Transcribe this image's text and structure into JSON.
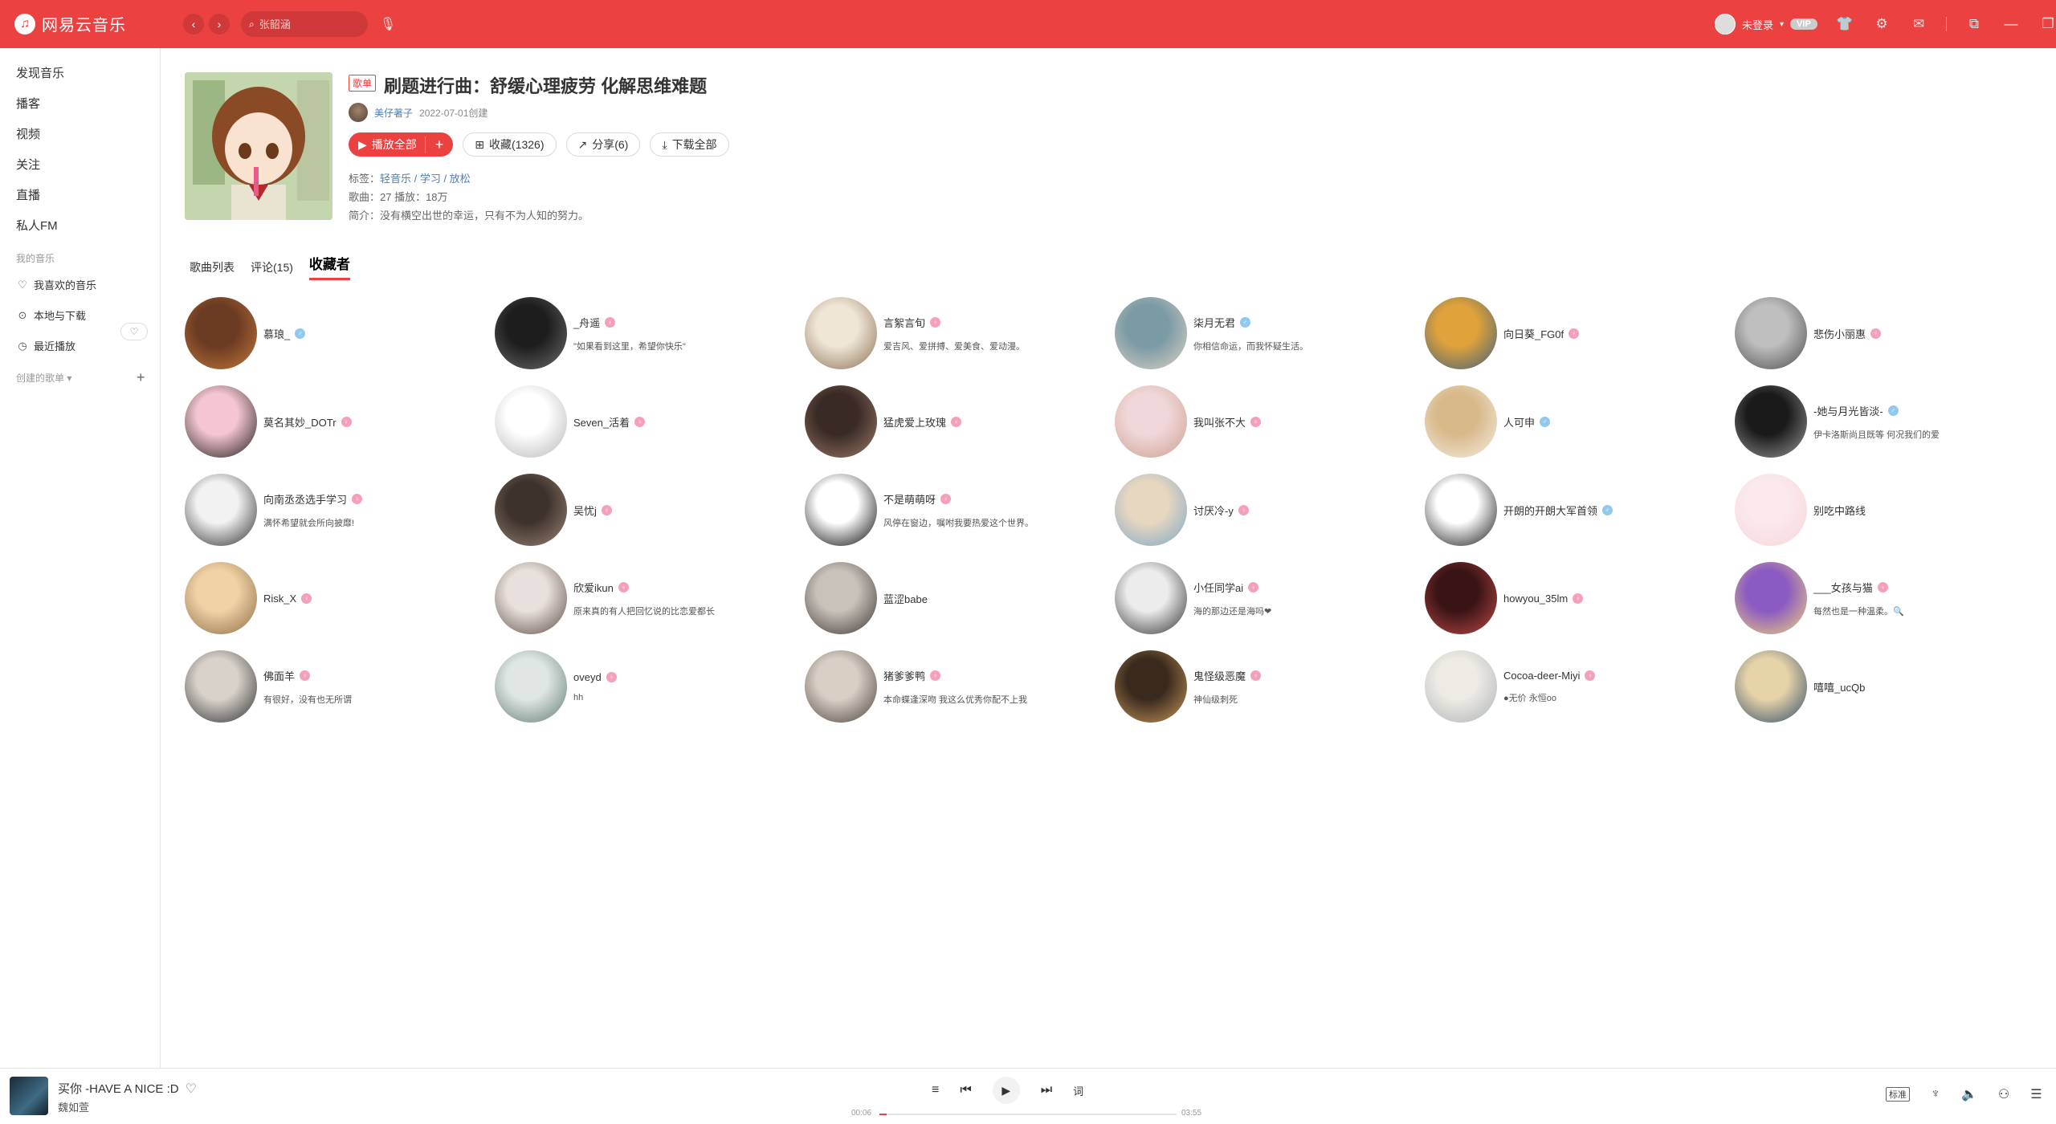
{
  "app": {
    "name": "网易云音乐"
  },
  "search": {
    "placeholder": "张韶涵"
  },
  "user": {
    "name": "未登录",
    "vip": "VIP"
  },
  "sidebar": {
    "items": [
      "发现音乐",
      "播客",
      "视频",
      "关注",
      "直播",
      "私人FM"
    ],
    "my_music_header": "我的音乐",
    "my_music": [
      "我喜欢的音乐",
      "本地与下载",
      "最近播放"
    ],
    "created_header": "创建的歌单"
  },
  "playlist": {
    "tag": "歌单",
    "title": "刷题进行曲：舒缓心理疲劳 化解思维难题",
    "creator": "美仔著子",
    "created": "2022-07-01创建",
    "play_all": "播放全部",
    "collect": "收藏(1326)",
    "share": "分享(6)",
    "download": "下载全部",
    "tags_label": "标签：",
    "tags": "轻音乐 / 学习 / 放松",
    "stats": "歌曲：27    播放：18万",
    "intro": "简介：没有横空出世的幸运，只有不为人知的努力。"
  },
  "tabs": [
    "歌曲列表",
    "评论(15)",
    "收藏者"
  ],
  "subscribers": [
    {
      "name": "慕琅_",
      "sig": "",
      "gender": "m",
      "c1": "#6b3a22",
      "c2": "#c47a3c"
    },
    {
      "name": "_舟遥",
      "sig": "\"如果看到这里，希望你快乐\"",
      "gender": "f",
      "c1": "#1d1d1d",
      "c2": "#6e6e6e"
    },
    {
      "name": "言絮言旬",
      "sig": "爱吉风、爱拼搏、爱美食、爱动漫。",
      "gender": "f",
      "c1": "#efe6d6",
      "c2": "#8a6d52"
    },
    {
      "name": "柒月无君",
      "sig": "你相信命运，而我怀疑生活。",
      "gender": "m",
      "c1": "#7a9aa6",
      "c2": "#dcd2c0"
    },
    {
      "name": "向日葵_FG0f",
      "sig": "",
      "gender": "f",
      "c1": "#e0a23a",
      "c2": "#3c5f7e"
    },
    {
      "name": "悲伤小丽惠",
      "sig": "",
      "gender": "f",
      "c1": "#bfbfbf",
      "c2": "#4a4a4a"
    },
    {
      "name": "莫名其妙_DOTr",
      "sig": "",
      "gender": "f",
      "c1": "#f5c6cf",
      "c2": "#1a1a1a"
    },
    {
      "name": "Seven_活着",
      "sig": "",
      "gender": "f",
      "c1": "#ffffff",
      "c2": "#b5b5b5"
    },
    {
      "name": "猛虎爱上玫瑰",
      "sig": "",
      "gender": "f",
      "c1": "#3a2a25",
      "c2": "#9d7b6a"
    },
    {
      "name": "我叫张不大",
      "sig": "",
      "gender": "f",
      "c1": "#f1d7d9",
      "c2": "#caa08f"
    },
    {
      "name": "人可申",
      "sig": "",
      "gender": "m",
      "c1": "#d8b98a",
      "c2": "#f4eee3"
    },
    {
      "name": "-她与月光皆淡-",
      "sig": "伊卡洛斯尚且既等 何况我们的爱",
      "gender": "m",
      "c1": "#1a1a1a",
      "c2": "#9a9a9a"
    },
    {
      "name": "向南丞丞选手学习",
      "sig": "满怀希望就会所向披靡!",
      "gender": "f",
      "c1": "#f2f2f2",
      "c2": "#2a2a2a"
    },
    {
      "name": "吴忧j",
      "sig": "",
      "gender": "f",
      "c1": "#3e332c",
      "c2": "#9b8676"
    },
    {
      "name": "不是萌萌呀",
      "sig": "风停在窗边，嘱咐我要热爱这个世界。",
      "gender": "f",
      "c1": "#ffffff",
      "c2": "#000000"
    },
    {
      "name": "讨厌冷-y",
      "sig": "",
      "gender": "f",
      "c1": "#e8d7c0",
      "c2": "#7aa6c8"
    },
    {
      "name": "开朗的开朗大军首领",
      "sig": "",
      "gender": "m",
      "c1": "#ffffff",
      "c2": "#111111"
    },
    {
      "name": "别吃中路线",
      "sig": "",
      "gender": "",
      "c1": "#fbe9ec",
      "c2": "#f6d6dc"
    },
    {
      "name": "Risk_X",
      "sig": "",
      "gender": "f",
      "c1": "#f0d2a6",
      "c2": "#8a6a44"
    },
    {
      "name": "欣爱ikun",
      "sig": "原来真的有人把回忆说的比恋爱都长",
      "gender": "f",
      "c1": "#e8e0dc",
      "c2": "#5a4a44"
    },
    {
      "name": "蓝涩babe",
      "sig": "",
      "gender": "",
      "c1": "#c9c2bb",
      "c2": "#3a3432"
    },
    {
      "name": "小任同学ai",
      "sig": "海的那边还是海吗❤",
      "gender": "f",
      "c1": "#ececec",
      "c2": "#2d2d2d"
    },
    {
      "name": "howyou_35lm",
      "sig": "",
      "gender": "f",
      "c1": "#3a1414",
      "c2": "#c04a4a"
    },
    {
      "name": "___女孩与猫",
      "sig": "每然也是一种温柔。🔍",
      "gender": "f",
      "c1": "#8a5bc2",
      "c2": "#f3d47a"
    },
    {
      "name": "佛面羊",
      "sig": "有很好，没有也无所谓",
      "gender": "f",
      "c1": "#d8d2cb",
      "c2": "#2c2c2c"
    },
    {
      "name": "oveyd",
      "sig": "hh",
      "gender": "f",
      "c1": "#dfe6e3",
      "c2": "#5f7a74"
    },
    {
      "name": "猪爹爹鸭",
      "sig": "本命蝶逢深吻 我这么优秀你配不上我",
      "gender": "f",
      "c1": "#d8cfc5",
      "c2": "#4a4038"
    },
    {
      "name": "鬼怪级恶魔",
      "sig": "神仙级刺死",
      "gender": "f",
      "c1": "#3a2a1e",
      "c2": "#c99a5a"
    },
    {
      "name": "Cocoa-deer-Miyi",
      "sig": "●无价  永恒oo",
      "gender": "f",
      "c1": "#eeeae4",
      "c2": "#aab3b6"
    },
    {
      "name": "嘻嘻_ucQb",
      "sig": "",
      "gender": "",
      "c1": "#e7d3a8",
      "c2": "#2d4a6b"
    }
  ],
  "player": {
    "title": "买你 -HAVE A NICE :D",
    "artist": "魏如萱",
    "time_current": "00:06",
    "time_total": "03:55",
    "progress": 0.025,
    "lyric_btn": "词",
    "quality": "标准"
  },
  "colors": {
    "brand": "#ec4141",
    "link": "#507daf"
  }
}
